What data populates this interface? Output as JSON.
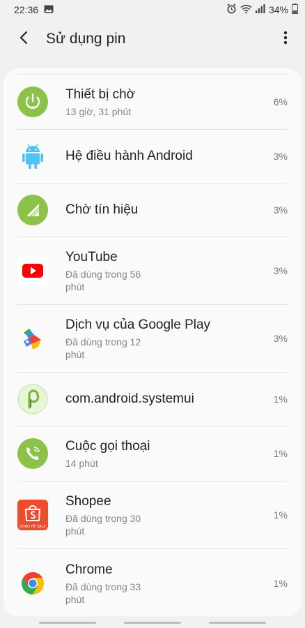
{
  "status_bar": {
    "time": "22:36",
    "battery_percent": "34%",
    "icons": [
      "image-icon",
      "alarm-icon",
      "wifi-icon",
      "signal-icon",
      "battery-icon"
    ]
  },
  "app_bar": {
    "title": "Sử dụng pin",
    "back_icon": "back-arrow-icon",
    "more_icon": "more-vert-icon"
  },
  "items": [
    {
      "title": "Thiết bị chờ",
      "sub": "13 giờ, 31 phút",
      "percent": "6%",
      "icon": "power-standby-icon"
    },
    {
      "title": "Hệ điều hành Android",
      "sub": "",
      "percent": "3%",
      "icon": "android-icon"
    },
    {
      "title": "Chờ tín hiệu",
      "sub": "",
      "percent": "3%",
      "icon": "signal-standby-icon"
    },
    {
      "title": "YouTube",
      "sub": "Đã dùng trong 56 phút",
      "percent": "3%",
      "icon": "youtube-icon"
    },
    {
      "title": "Dịch vụ của Google Play",
      "sub": "Đã dùng trong 12 phút",
      "percent": "3%",
      "icon": "google-play-services-icon"
    },
    {
      "title": "com.android.systemui",
      "sub": "",
      "percent": "1%",
      "icon": "android-p-icon"
    },
    {
      "title": "Cuộc gọi thoại",
      "sub": "14 phút",
      "percent": "1%",
      "icon": "phone-call-icon"
    },
    {
      "title": "Shopee",
      "sub": "Đã dùng trong 30 phút",
      "percent": "1%",
      "icon": "shopee-icon",
      "icon_text": "CHÀO HÈ SALE"
    },
    {
      "title": "Chrome",
      "sub": "Đã dùng trong 33 phút",
      "percent": "1%",
      "icon": "chrome-icon"
    }
  ],
  "colors": {
    "background": "#f1f1f1",
    "card": "#fafafa",
    "green_circle": "#8bc34a",
    "youtube_red": "#ff0000",
    "shopee_orange": "#ee4d2d",
    "android_blue": "#4fc3f7"
  }
}
